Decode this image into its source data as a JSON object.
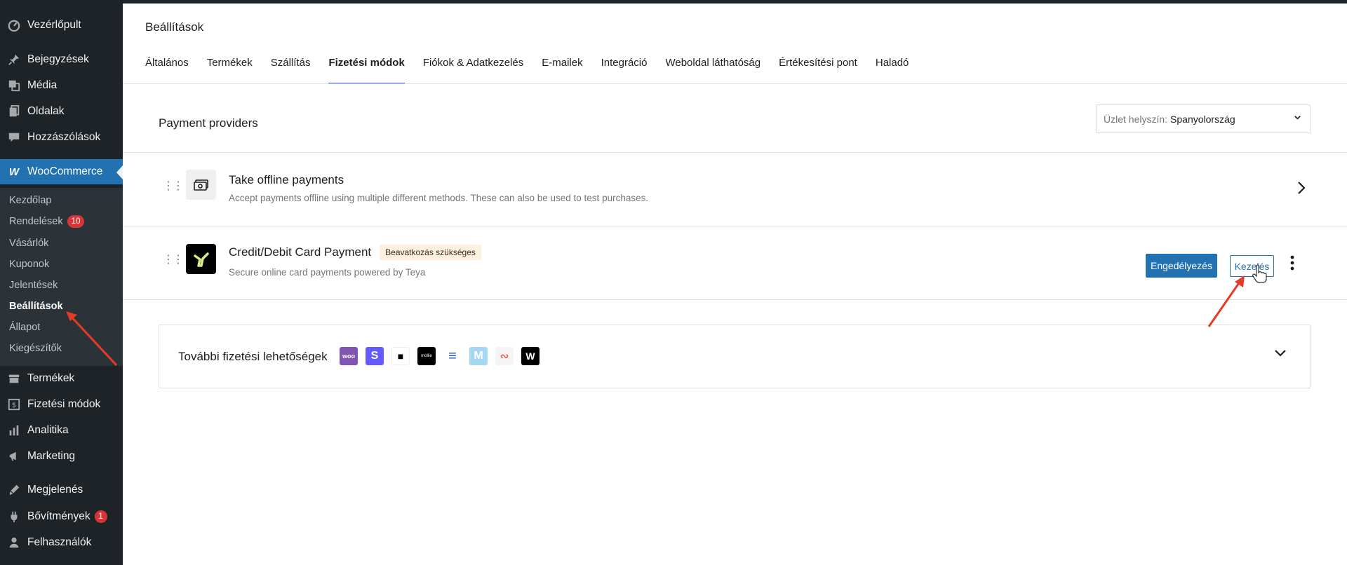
{
  "sidebar": {
    "items_top": [
      {
        "label": "Vezérlőpult",
        "icon": "dashboard-icon"
      },
      {
        "label": "Bejegyzések",
        "icon": "pin-icon"
      },
      {
        "label": "Média",
        "icon": "media-icon"
      },
      {
        "label": "Oldalak",
        "icon": "pages-icon"
      },
      {
        "label": "Hozzászólások",
        "icon": "comments-icon"
      },
      {
        "label": "WooCommerce",
        "icon": "woocommerce-icon"
      }
    ],
    "submenu": [
      {
        "label": "Kezdőlap"
      },
      {
        "label": "Rendelések",
        "badge": "10"
      },
      {
        "label": "Vásárlók"
      },
      {
        "label": "Kuponok"
      },
      {
        "label": "Jelentések"
      },
      {
        "label": "Beállítások"
      },
      {
        "label": "Állapot"
      },
      {
        "label": "Kiegészítők"
      }
    ],
    "items_bottom": [
      {
        "label": "Termékek",
        "icon": "products-icon"
      },
      {
        "label": "Fizetési módok",
        "icon": "payments-icon"
      },
      {
        "label": "Analitika",
        "icon": "analytics-icon"
      },
      {
        "label": "Marketing",
        "icon": "megaphone-icon"
      },
      {
        "label": "Megjelenés",
        "icon": "brush-icon"
      },
      {
        "label": "Bővítmények",
        "icon": "plugins-icon",
        "badge": "1"
      },
      {
        "label": "Felhasználók",
        "icon": "users-icon"
      }
    ]
  },
  "header": {
    "title": "Beállítások",
    "tabs": [
      "Általános",
      "Termékek",
      "Szállítás",
      "Fizetési módok",
      "Fiókok & Adatkezelés",
      "E-mailek",
      "Integráció",
      "Weboldal láthatóság",
      "Értékesítési pont",
      "Haladó"
    ]
  },
  "payments": {
    "title": "Payment providers",
    "location_label": "Üzlet helyszín:",
    "location_value": "Spanyolország",
    "offline": {
      "name": "Take offline payments",
      "desc": "Accept payments offline using multiple different methods. These can also be used to test purchases."
    },
    "card": {
      "name": "Credit/Debit Card Payment",
      "status": "Beavatkozás szükséges",
      "desc": "Secure online card payments powered by Teya",
      "enable_label": "Engedélyezés",
      "manage_label": "Kezelés"
    },
    "more": {
      "title": "További fizetési lehetőségek",
      "logos": [
        {
          "text": "woo",
          "color": "#7f54b3"
        },
        {
          "text": "S",
          "color": "#635bff"
        },
        {
          "text": "■",
          "color": "#ffffff"
        },
        {
          "text": "mollie",
          "color": "#000000"
        },
        {
          "text": "≡",
          "color": "#ffffff"
        },
        {
          "text": "M",
          "color": "#a3d8f0"
        },
        {
          "text": "∾",
          "color": "#f5f5f5"
        },
        {
          "text": "W",
          "color": "#000000"
        }
      ]
    }
  },
  "colors": {
    "accent": "#2271b1",
    "tab_indicator": "#3858e9",
    "annotation": "#e53a25"
  }
}
